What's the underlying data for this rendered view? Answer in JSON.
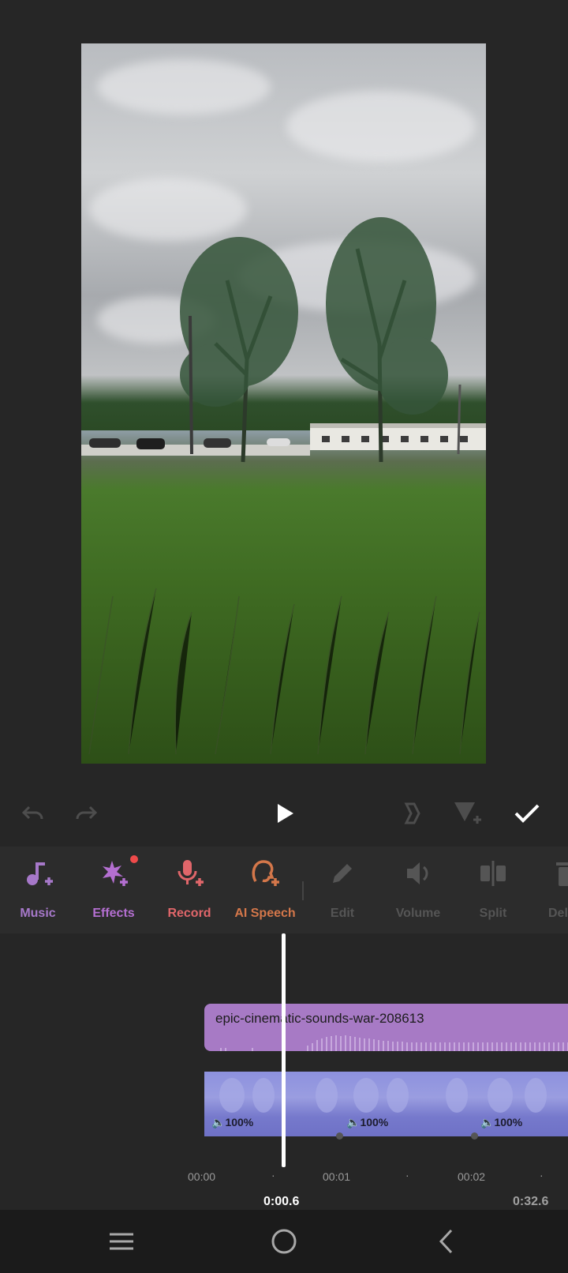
{
  "preview": {
    "image": "grassy field with two trees under cloudy sky"
  },
  "playback": {
    "undo_icon": "undo-icon",
    "redo_icon": "redo-icon",
    "play_icon": "play-icon",
    "keyframe_icon": "keyframe-icon",
    "marker_icon": "add-marker-icon",
    "confirm_icon": "check-icon"
  },
  "toolbar": {
    "tools": [
      {
        "label": "Music",
        "color": "#a678c9",
        "icon": "music-add-icon"
      },
      {
        "label": "Effects",
        "color": "#b46fd1",
        "icon": "effects-add-icon",
        "badge": true
      },
      {
        "label": "Record",
        "color": "#e0666a",
        "icon": "mic-add-icon"
      },
      {
        "label": "AI Speech",
        "color": "#d4774a",
        "icon": "ai-speech-add-icon"
      },
      {
        "label": "Edit",
        "color": "#555555",
        "icon": "pencil-icon"
      },
      {
        "label": "Volume",
        "color": "#555555",
        "icon": "volume-icon"
      },
      {
        "label": "Split",
        "color": "#555555",
        "icon": "split-icon"
      },
      {
        "label": "Del",
        "color": "#555555",
        "icon": "delete-icon"
      }
    ]
  },
  "timeline": {
    "audio_clip": {
      "title": "epic-cinematic-sounds-war-208613"
    },
    "video_clip": {
      "volumes": [
        "100%",
        "100%",
        "100%"
      ]
    },
    "ticks": [
      "00:00",
      "00:01",
      "00:02"
    ],
    "current_time": "0:00.6",
    "total_time": "0:32.6"
  },
  "navbar": {
    "menu_icon": "recents-icon",
    "home_icon": "home-icon",
    "back_icon": "back-icon"
  }
}
